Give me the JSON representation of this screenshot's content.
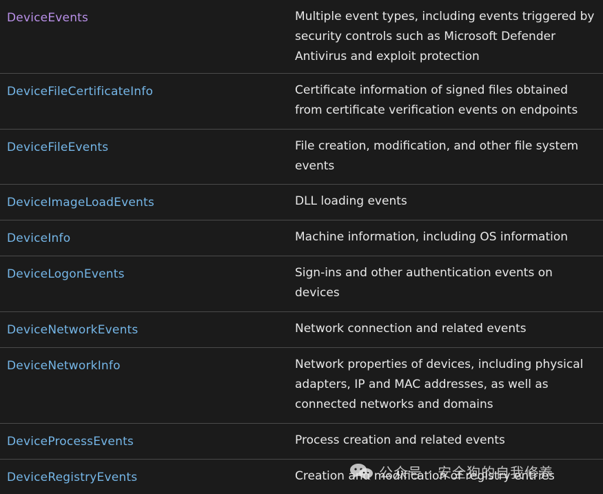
{
  "rows": [
    {
      "name": "DeviceEvents",
      "description": "Multiple event types, including events triggered by security controls such as Microsoft Defender Antivirus and exploit protection"
    },
    {
      "name": "DeviceFileCertificateInfo",
      "description": "Certificate information of signed files obtained from certificate verification events on endpoints"
    },
    {
      "name": "DeviceFileEvents",
      "description": "File creation, modification, and other file system events"
    },
    {
      "name": "DeviceImageLoadEvents",
      "description": "DLL loading events"
    },
    {
      "name": "DeviceInfo",
      "description": "Machine information, including OS information"
    },
    {
      "name": "DeviceLogonEvents",
      "description": "Sign-ins and other authentication events on devices"
    },
    {
      "name": "DeviceNetworkEvents",
      "description": "Network connection and related events"
    },
    {
      "name": "DeviceNetworkInfo",
      "description": "Network properties of devices, including physical adapters, IP and MAC addresses, as well as connected networks and domains"
    },
    {
      "name": "DeviceProcessEvents",
      "description": "Process creation and related events"
    },
    {
      "name": "DeviceRegistryEvents",
      "description": "Creation and modification of registry entries"
    }
  ],
  "watermark": {
    "text": "公众号 · 安全狗的自我修养",
    "icon": "wechat-icon"
  },
  "colors": {
    "background": "#1b1b1b",
    "link": "#75b6e7",
    "visited_link": "#b990e8",
    "text": "#e8e8e8",
    "divider": "#4b4b4b"
  }
}
